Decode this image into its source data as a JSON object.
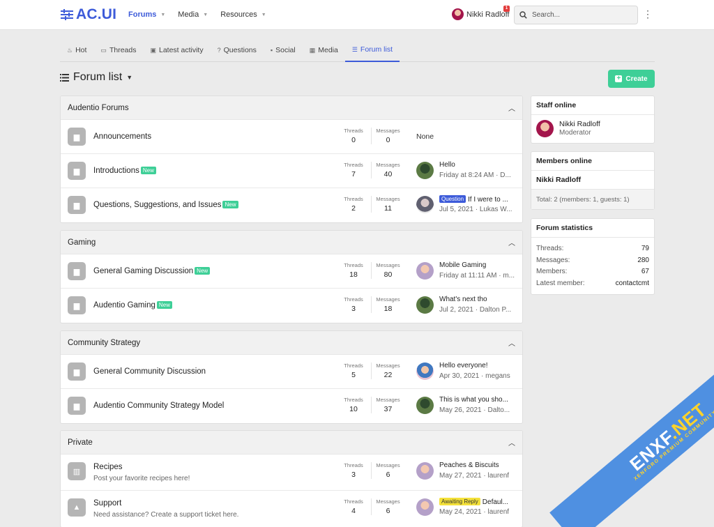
{
  "header": {
    "logo_text": "AC.UI",
    "nav": [
      {
        "label": "Forums",
        "active": true
      },
      {
        "label": "Media",
        "active": false
      },
      {
        "label": "Resources",
        "active": false
      }
    ],
    "user_name": "Nikki Radloff",
    "alert_count": "1",
    "search_placeholder": "Search..."
  },
  "tabs": [
    {
      "label": "Hot",
      "icon": "flame-icon"
    },
    {
      "label": "Threads",
      "icon": "comment-icon"
    },
    {
      "label": "Latest activity",
      "icon": "activity-icon"
    },
    {
      "label": "Questions",
      "icon": "question-icon"
    },
    {
      "label": "Social",
      "icon": "social-icon"
    },
    {
      "label": "Media",
      "icon": "media-icon"
    },
    {
      "label": "Forum list",
      "icon": "list-icon",
      "active": true
    }
  ],
  "page": {
    "title": "Forum list",
    "create_label": "Create"
  },
  "labels": {
    "threads": "Threads",
    "messages": "Messages",
    "new": "New"
  },
  "categories": [
    {
      "title": "Audentio Forums",
      "nodes": [
        {
          "title": "Announcements",
          "threads": "0",
          "messages": "0",
          "last_none": "None"
        },
        {
          "title": "Introductions",
          "is_new": true,
          "threads": "7",
          "messages": "40",
          "last_title": "Hello",
          "last_meta": "Friday at 8:24 AM · D..."
        },
        {
          "title": "Questions, Suggestions, and Issues",
          "is_new": true,
          "threads": "2",
          "messages": "11",
          "last_prefix": "Question",
          "last_title": "If I were to ...",
          "last_meta": "Jul 5, 2021 · Lukas W..."
        }
      ]
    },
    {
      "title": "Gaming",
      "nodes": [
        {
          "title": "General Gaming Discussion",
          "is_new": true,
          "threads": "18",
          "messages": "80",
          "last_title": "Mobile Gaming",
          "last_meta": "Friday at 11:11 AM · m..."
        },
        {
          "title": "Audentio Gaming",
          "is_new": true,
          "threads": "3",
          "messages": "18",
          "last_title": "What's next tho",
          "last_meta": "Jul 2, 2021 · Dalton P..."
        }
      ]
    },
    {
      "title": "Community Strategy",
      "nodes": [
        {
          "title": "General Community Discussion",
          "threads": "5",
          "messages": "22",
          "last_title": "Hello everyone!",
          "last_meta": "Apr 30, 2021 · megans"
        },
        {
          "title": "Audentio Community Strategy Model",
          "threads": "10",
          "messages": "37",
          "last_title": "This is what you sho...",
          "last_meta": "May 26, 2021 · Dalto..."
        }
      ]
    },
    {
      "title": "Private",
      "nodes": [
        {
          "title": "Recipes",
          "desc": "Post your favorite recipes here!",
          "threads": "3",
          "messages": "6",
          "last_title": "Peaches & Biscuits",
          "last_meta": "May 27, 2021 · laurenf"
        },
        {
          "title": "Support",
          "desc": "Need assistance? Create a support ticket here.",
          "threads": "4",
          "messages": "6",
          "last_prefix": "Awaiting Reply",
          "last_title": "Defaul...",
          "last_meta": "May 24, 2021 · laurenf"
        }
      ]
    }
  ],
  "sidebar": {
    "staff_title": "Staff online",
    "staff_name": "Nikki Radloff",
    "staff_role": "Moderator",
    "members_title": "Members online",
    "member_name": "Nikki Radloff",
    "members_total": "Total: 2 (members: 1, guests: 1)",
    "stats_title": "Forum statistics",
    "stats": [
      {
        "label": "Threads:",
        "value": "79"
      },
      {
        "label": "Messages:",
        "value": "280"
      },
      {
        "label": "Members:",
        "value": "67"
      },
      {
        "label": "Latest member:",
        "value": "contactcmt"
      }
    ]
  },
  "watermark": {
    "brand": "ENXF",
    "brand_suffix": ".NET",
    "tagline": "XENFORO PREMIUM COMMUNITY"
  }
}
